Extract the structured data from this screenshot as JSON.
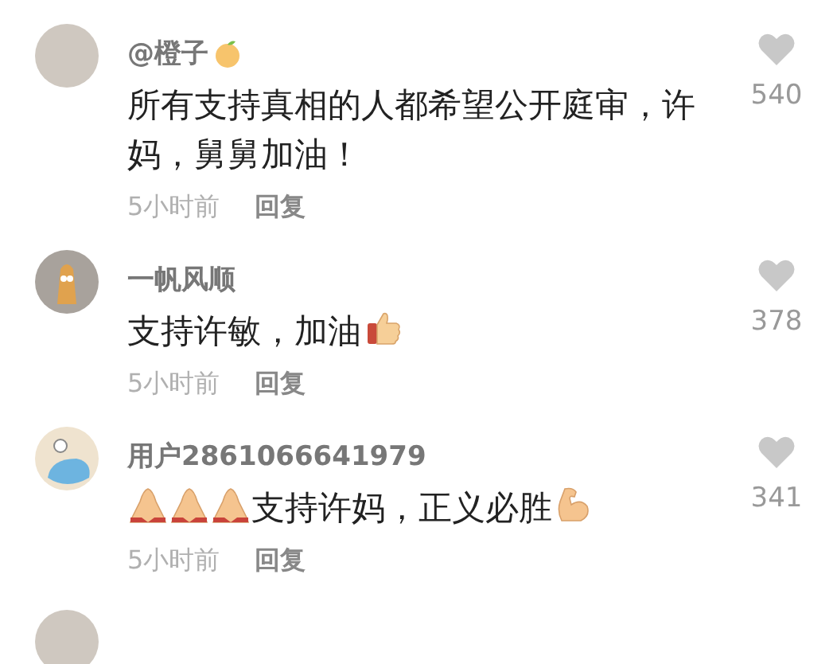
{
  "comments": [
    {
      "name": "@橙子",
      "name_badge": {
        "kind": "fruit"
      },
      "avatar": {
        "kind": "photo"
      },
      "body": [
        {
          "kind": "text",
          "text": "所有支持真相的人都希望公开庭审，许妈，舅舅加油！"
        }
      ],
      "time": "5小时前",
      "reply": "回复",
      "likes": "540"
    },
    {
      "name": "一帆风顺",
      "avatar": {
        "kind": "cartoon"
      },
      "body": [
        {
          "kind": "text",
          "text": "支持许敏，加油"
        },
        {
          "kind": "thumbs"
        }
      ],
      "time": "5小时前",
      "reply": "回复",
      "likes": "378"
    },
    {
      "name": "用户2861066641979",
      "avatar": {
        "kind": "creature"
      },
      "body": [
        {
          "kind": "pray"
        },
        {
          "kind": "pray"
        },
        {
          "kind": "pray"
        },
        {
          "kind": "text",
          "text": "支持许妈，正义必胜"
        },
        {
          "kind": "muscle"
        }
      ],
      "time": "5小时前",
      "reply": "回复",
      "likes": "341"
    }
  ],
  "partial_comment": {
    "avatar": {
      "kind": "photo"
    }
  }
}
